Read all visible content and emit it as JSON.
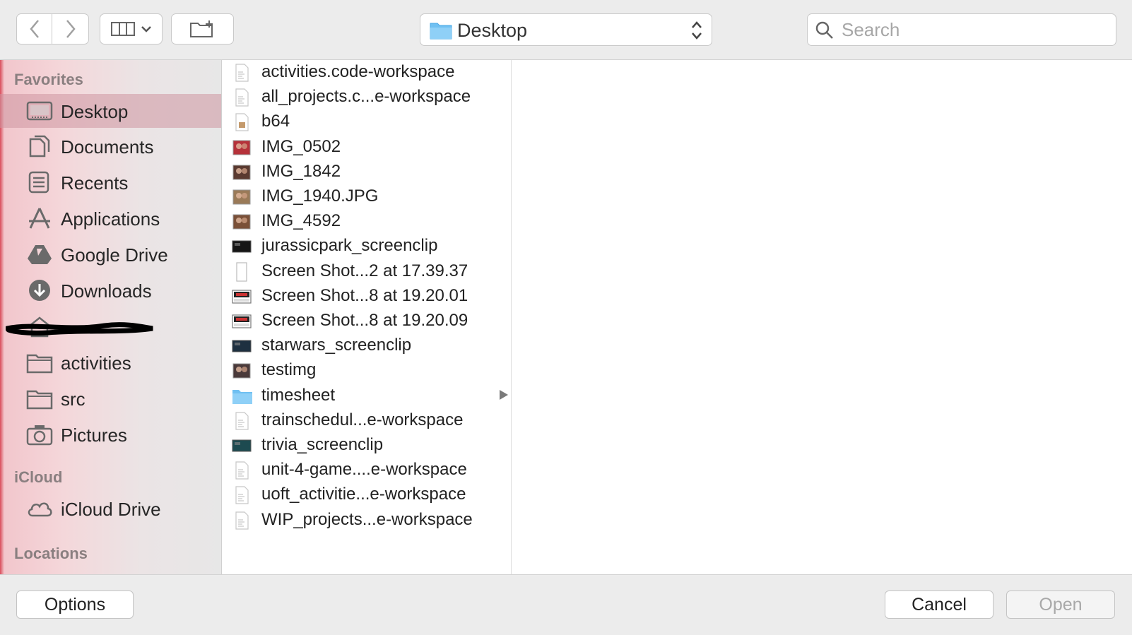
{
  "toolbar": {
    "back_icon": "chevron-left-icon",
    "forward_icon": "chevron-right-icon",
    "view_icon": "columns-view-icon",
    "new_folder_icon": "new-folder-icon",
    "location": "Desktop",
    "search_placeholder": "Search"
  },
  "sidebar": {
    "favorites_header": "Favorites",
    "favorites": [
      {
        "label": "Desktop",
        "icon": "desktop-icon",
        "selected": true
      },
      {
        "label": "Documents",
        "icon": "documents-icon"
      },
      {
        "label": "Recents",
        "icon": "recents-icon"
      },
      {
        "label": "Applications",
        "icon": "applications-icon"
      },
      {
        "label": "Google Drive",
        "icon": "google-drive-icon"
      },
      {
        "label": "Downloads",
        "icon": "downloads-icon"
      },
      {
        "label": "",
        "icon": "home-icon",
        "redacted": true
      },
      {
        "label": "activities",
        "icon": "folder-icon"
      },
      {
        "label": "src",
        "icon": "folder-icon"
      },
      {
        "label": "Pictures",
        "icon": "camera-icon"
      }
    ],
    "icloud_header": "iCloud",
    "icloud": [
      {
        "label": "iCloud Drive",
        "icon": "cloud-icon"
      }
    ],
    "locations_header": "Locations"
  },
  "files": [
    {
      "name": "activities.code-workspace",
      "kind": "doc"
    },
    {
      "name": "all_projects.c...e-workspace",
      "kind": "doc"
    },
    {
      "name": "b64",
      "kind": "doc-image"
    },
    {
      "name": "IMG_0502",
      "kind": "photo",
      "color": "#b5323a"
    },
    {
      "name": "IMG_1842",
      "kind": "photo",
      "color": "#5a3a30"
    },
    {
      "name": "IMG_1940.JPG",
      "kind": "photo",
      "color": "#9a7a58"
    },
    {
      "name": "IMG_4592",
      "kind": "photo",
      "color": "#7a5038"
    },
    {
      "name": "jurassicpark_screenclip",
      "kind": "video",
      "color": "#151515"
    },
    {
      "name": "Screen Shot...2 at 17.39.37",
      "kind": "blank"
    },
    {
      "name": "Screen Shot...8 at 19.20.01",
      "kind": "screenshot"
    },
    {
      "name": "Screen Shot...8 at 19.20.09",
      "kind": "screenshot"
    },
    {
      "name": "starwars_screenclip",
      "kind": "video",
      "color": "#1e3040"
    },
    {
      "name": "testimg",
      "kind": "photo",
      "color": "#4a3a3a"
    },
    {
      "name": "timesheet",
      "kind": "folder",
      "has_children": true
    },
    {
      "name": "trainschedul...e-workspace",
      "kind": "doc"
    },
    {
      "name": "trivia_screenclip",
      "kind": "video",
      "color": "#1d4a50"
    },
    {
      "name": "unit-4-game....e-workspace",
      "kind": "doc"
    },
    {
      "name": "uoft_activitie...e-workspace",
      "kind": "doc"
    },
    {
      "name": "WIP_projects...e-workspace",
      "kind": "doc"
    }
  ],
  "buttons": {
    "options": "Options",
    "cancel": "Cancel",
    "open": "Open"
  }
}
